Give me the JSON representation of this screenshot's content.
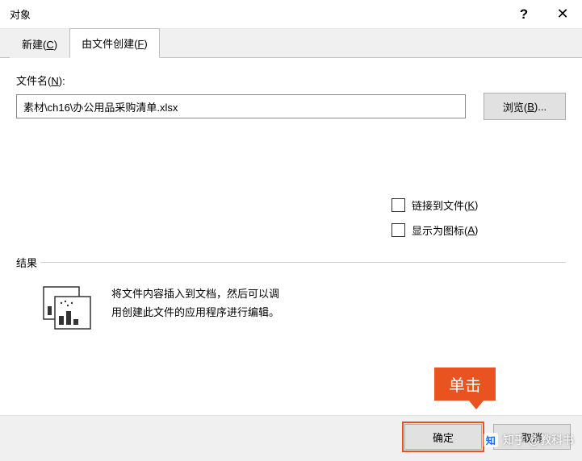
{
  "titlebar": {
    "title": "对象",
    "help_symbol": "?",
    "close_symbol": "✕"
  },
  "tabs": {
    "new": {
      "label_pre": "新建(",
      "hotkey": "C",
      "label_post": ")"
    },
    "fromfile": {
      "label_pre": "由文件创建(",
      "hotkey": "F",
      "label_post": ")"
    }
  },
  "filename": {
    "label_pre": "文件名(",
    "hotkey": "N",
    "label_post": "):",
    "value": "素材\\ch16\\办公用品采购清单.xlsx"
  },
  "browse": {
    "label_pre": "浏览(",
    "hotkey": "B",
    "label_post": ")..."
  },
  "options": {
    "link": {
      "label_pre": "链接到文件(",
      "hotkey": "K",
      "label_post": ")"
    },
    "icon": {
      "label_pre": "显示为图标(",
      "hotkey": "A",
      "label_post": ")"
    }
  },
  "result": {
    "heading": "结果",
    "line1": "将文件内容插入到文档，然后可以调",
    "line2": "用创建此文件的应用程序进行编辑。"
  },
  "buttons": {
    "ok": "确定",
    "cancel": "取消"
  },
  "callout": {
    "text": "单击"
  },
  "watermark": {
    "logo": "知",
    "text": "知乎 @教科书"
  }
}
